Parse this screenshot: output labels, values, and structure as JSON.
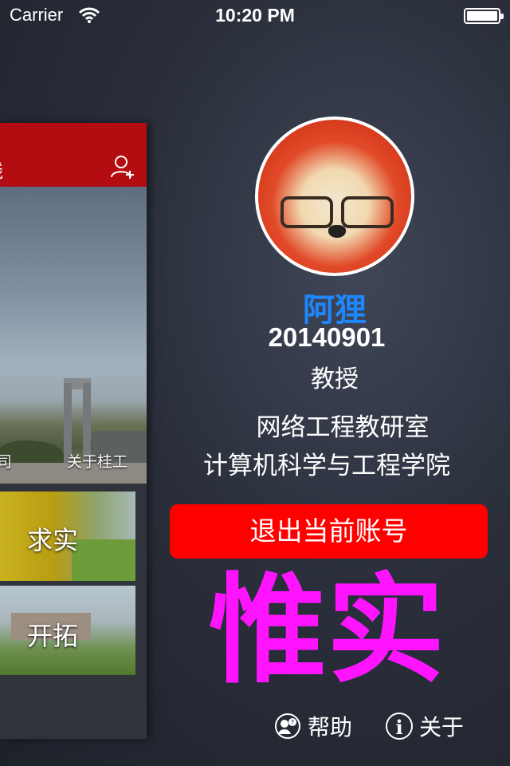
{
  "status_bar": {
    "carrier": "Carrier",
    "time": "10:20 PM",
    "battery_level": 1.0
  },
  "main_panel": {
    "nav_title": "线",
    "add_user_icon": "add-user-icon",
    "hero_caption": "关于桂工",
    "hero_caption_left": "司",
    "tiles": [
      {
        "label": "求实"
      },
      {
        "label": "开拓"
      }
    ]
  },
  "profile": {
    "name": "阿狸",
    "id": "20140901",
    "title": "教授",
    "department": "网络工程教研室",
    "college": "计算机科学与工程学院"
  },
  "logout_label": "退出当前账号",
  "slogan": "惟实",
  "footer": {
    "help_label": "帮助",
    "about_label": "关于"
  },
  "colors": {
    "nav_red": "#b30d12",
    "name_blue": "#1e87ff",
    "logout_red": "#ff0000",
    "slogan_magenta": "#ff14ff"
  }
}
